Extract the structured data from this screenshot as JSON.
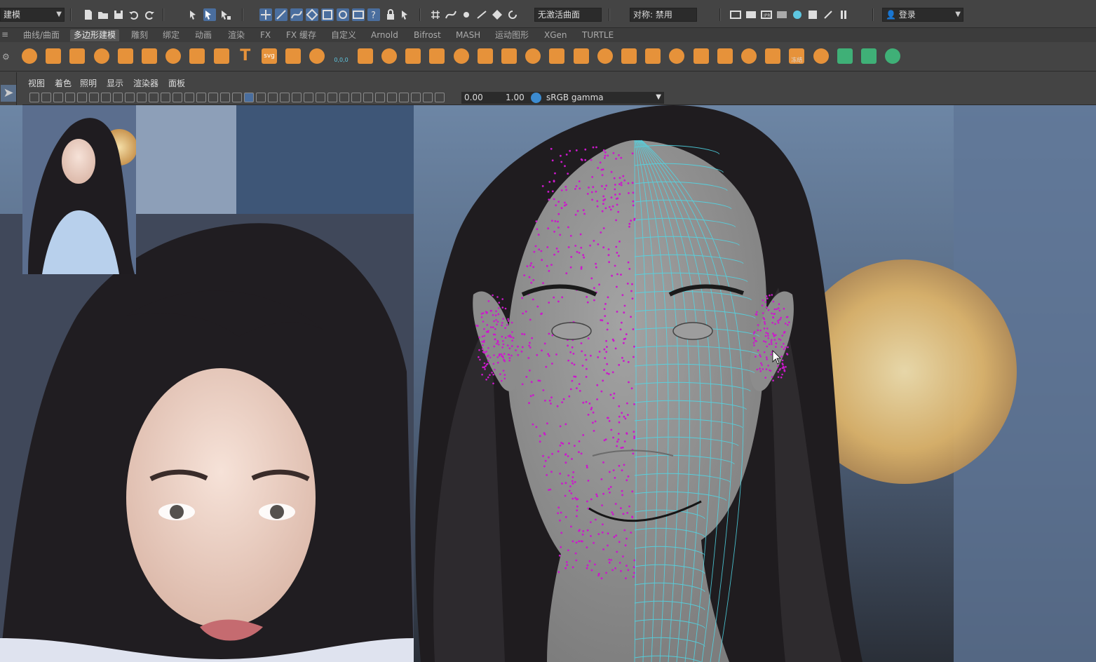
{
  "window": {
    "menu_set": "建模",
    "live_surface": "无激活曲面",
    "symmetry": "对称: 禁用",
    "login": "登录"
  },
  "shelf_tabs": [
    {
      "label": "曲线/曲面",
      "active": false
    },
    {
      "label": "多边形建模",
      "active": true
    },
    {
      "label": "雕刻",
      "active": false
    },
    {
      "label": "绑定",
      "active": false
    },
    {
      "label": "动画",
      "active": false
    },
    {
      "label": "渲染",
      "active": false
    },
    {
      "label": "FX",
      "active": false
    },
    {
      "label": "FX 缓存",
      "active": false
    },
    {
      "label": "自定义",
      "active": false
    },
    {
      "label": "Arnold",
      "active": false
    },
    {
      "label": "Bifrost",
      "active": false
    },
    {
      "label": "MASH",
      "active": false
    },
    {
      "label": "运动图形",
      "active": false
    },
    {
      "label": "XGen",
      "active": false
    },
    {
      "label": "TURTLE",
      "active": false
    }
  ],
  "shelf_icons": [
    "sphere-icon",
    "cube-icon",
    "cylinder-icon",
    "cone-icon",
    "torus-icon",
    "plane-icon",
    "disc-icon",
    "platonic-icon",
    "sweep-icon",
    "type-icon",
    "svg-icon",
    "bevel-tool-icon",
    "bridge-icon",
    "soccer-icon",
    "combine-icon",
    "separate-icon",
    "extract-icon",
    "smooth-icon",
    "mirror-icon",
    "extrude-icon",
    "bevel-icon",
    "merge-icon",
    "fill-hole-icon",
    "cut-icon",
    "insert-loop-icon",
    "multi-cut-icon",
    "target-weld-icon",
    "crease-icon",
    "uv-icon",
    "unfold-icon",
    "layout-icon",
    "sew-icon",
    "freeze-icon",
    "center-pivot-icon",
    "history-icon",
    "freeze-transform-icon",
    "snap-icon"
  ],
  "text_labels": {
    "type_tool": "T",
    "svg_tool": "svg",
    "soccer_label": "0,0,0",
    "freeze_label": "冻结变"
  },
  "panel_menu": [
    "视图",
    "着色",
    "照明",
    "显示",
    "渲染器",
    "面板"
  ],
  "panel_toolbar": {
    "exposure": "0.00",
    "gamma": "1.00",
    "color_space": "sRGB gamma"
  },
  "colors": {
    "ui_bg": "#444444",
    "field_bg": "#2b2b2b",
    "active_tab": "#555555",
    "highlight": "#4a6e9e",
    "wire": "#4fd9e8",
    "vertex": "#cc18cc",
    "shelf_orange": "#e6923a",
    "shelf_green": "#3fb077"
  }
}
